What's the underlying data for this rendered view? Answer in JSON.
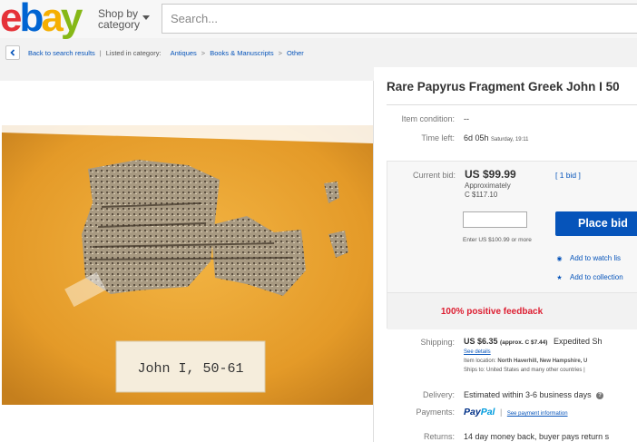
{
  "header": {
    "logo": [
      "e",
      "b",
      "a",
      "y"
    ],
    "shop_by": "Shop by category",
    "search_placeholder": "Search..."
  },
  "breadcrumb": {
    "back": "Back to search results",
    "listed": "Listed in category:",
    "items": [
      "Antiques",
      "Books & Manuscripts",
      "Other"
    ]
  },
  "image": {
    "label": "John I, 50-61"
  },
  "item": {
    "title": "Rare Papyrus Fragment Greek John I 50",
    "condition_label": "Item condition:",
    "condition_value": "--",
    "time_left_label": "Time left:",
    "time_left_value": "6d 05h",
    "time_left_end": "Saturday, 19:11",
    "current_bid_label": "Current bid:",
    "current_bid_value": "US $99.99",
    "approx_label": "Approximately",
    "approx_value": "C $117.10",
    "bid_count": "[ 1 bid ]",
    "bid_hint": "Enter US $100.99 or more",
    "place_bid": "Place bid",
    "watch_list": "Add to watch lis",
    "collection": "Add to collection",
    "feedback": "100% positive feedback",
    "shipping_label": "Shipping:",
    "shipping_value": "US $6.35",
    "shipping_approx": "(approx. C $7.44)",
    "shipping_method": "Expedited Sh",
    "see_details": "See details",
    "item_location_label": "Item location:",
    "item_location": "North Haverhill, New Hampshire, U",
    "ships_to_label": "Ships to:",
    "ships_to": "United States and many other countries |",
    "delivery_label": "Delivery:",
    "delivery_value": "Estimated within 3-6 business days",
    "payments_label": "Payments:",
    "paypal_1": "Pay",
    "paypal_2": "Pal",
    "payment_link": "See payment information",
    "returns_label": "Returns:",
    "returns_value": "14 day money back, buyer pays return s"
  },
  "colors": {
    "place_bid": "#0654ba",
    "feedback": "#dd1e31",
    "link": "#0654ba"
  },
  "icons": [
    "chevron-left-icon",
    "chevron-down-icon",
    "eye-icon",
    "star-icon",
    "help-icon"
  ]
}
